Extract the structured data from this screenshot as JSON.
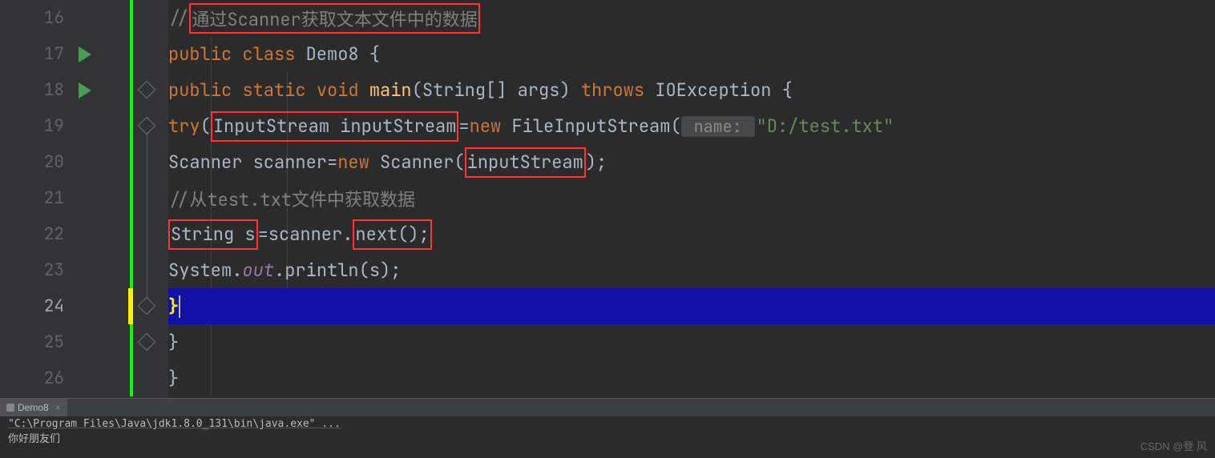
{
  "gutter": {
    "lines": [
      "16",
      "17",
      "18",
      "19",
      "20",
      "21",
      "22",
      "23",
      "24",
      "25",
      "26"
    ]
  },
  "code": {
    "l16_comment_pre": "//",
    "l16_comment": "通过Scanner获取文本文件中的数据",
    "l17_public": "public",
    "l17_class": " class ",
    "l17_name": "Demo8 {",
    "l18_public": "public",
    "l18_static": " static ",
    "l18_void": "void ",
    "l18_main": "main",
    "l18_args": "(String[] args) ",
    "l18_throws": "throws",
    "l18_exc": " IOException {",
    "l19_try": "try",
    "l19_open": "(",
    "l19_decl": "InputStream inputStream",
    "l19_eq": "=",
    "l19_new": "new ",
    "l19_fis": "FileInputStream(",
    "l19_hint": " name: ",
    "l19_path": "\"D:/test.txt\"",
    "l20_text1": "Scanner scanner=",
    "l20_new": "new ",
    "l20_text2": "Scanner(",
    "l20_arg": "inputStream",
    "l20_close": ");",
    "l21_comment": "//从test.txt文件中获取数据",
    "l22_str_s": "String s",
    "l22_eq": "=scanner.",
    "l22_next": "next();",
    "l23_sys": "System.",
    "l23_out": "out",
    "l23_println": ".println(s);",
    "l24_brace": "}",
    "l25_brace": "}",
    "l26_brace": "}"
  },
  "run": {
    "tab_name": "Demo8",
    "exec": "\"C:\\Program Files\\Java\\jdk1.8.0_131\\bin\\java.exe\" ...",
    "output": "你好朋友们"
  },
  "watermark": "CSDN @登 风"
}
